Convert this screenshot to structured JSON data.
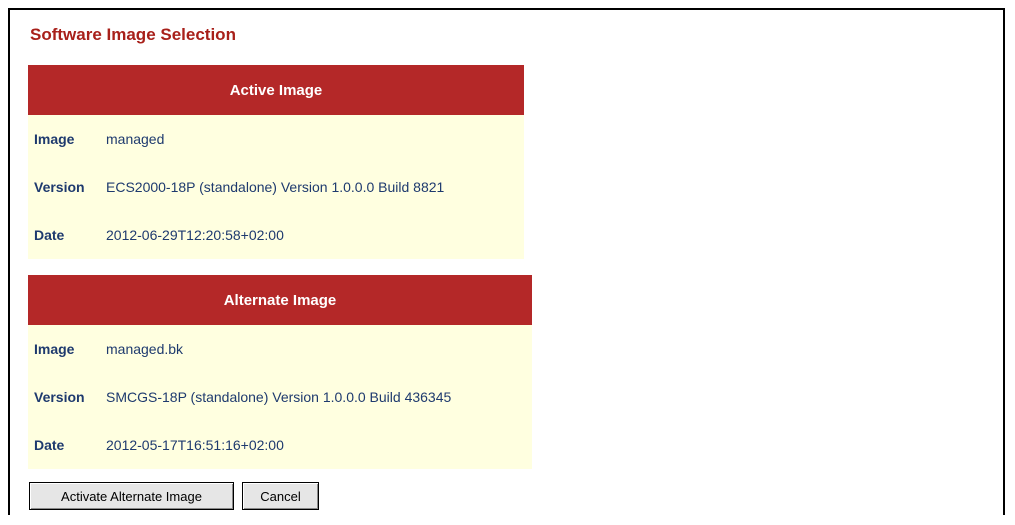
{
  "page": {
    "title": "Software Image Selection"
  },
  "active_image": {
    "header": "Active Image",
    "rows": [
      {
        "key": "Image",
        "value": "managed"
      },
      {
        "key": "Version",
        "value": "ECS2000-18P (standalone) Version 1.0.0.0 Build 8821"
      },
      {
        "key": "Date",
        "value": "2012-06-29T12:20:58+02:00"
      }
    ]
  },
  "alternate_image": {
    "header": "Alternate Image",
    "rows": [
      {
        "key": "Image",
        "value": "managed.bk"
      },
      {
        "key": "Version",
        "value": "SMCGS-18P (standalone) Version 1.0.0.0 Build 436345"
      },
      {
        "key": "Date",
        "value": "2012-05-17T16:51:16+02:00"
      }
    ]
  },
  "buttons": {
    "activate_label": "Activate Alternate Image",
    "cancel_label": "Cancel"
  },
  "colors": {
    "title": "#a8201a",
    "header_bg": "#b42828",
    "row_bg": "#ffffe0",
    "text": "#1e3a6e"
  }
}
